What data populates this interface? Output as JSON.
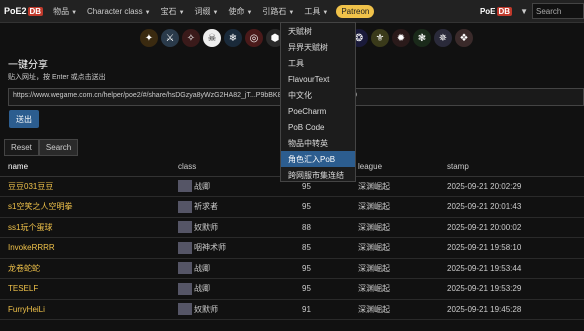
{
  "nav": {
    "logo": "PoE2",
    "logo_db": "DB",
    "items": [
      "物品",
      "Character class",
      "宝石",
      "词缀",
      "使命",
      "引路石",
      "工具"
    ],
    "patreon": "Patreon",
    "right_logo": "PoE",
    "right_logo_db": "DB",
    "search_placeholder": "Search",
    "lang": "▼"
  },
  "share": {
    "title": "一键分享",
    "desc": "贴入网址，按 Enter 或点击送出",
    "url": "https://www.wegame.com.cn/helper/poe2/#/share/hsDGzya8yWzG2HA82_jT...P9bBK8kKNyKcPSsOwjnKrli340",
    "send_label": "送出"
  },
  "tabs": [
    "Reset",
    "Search"
  ],
  "table": {
    "headers": [
      "name",
      "class",
      "level",
      "league",
      "stamp"
    ],
    "rows": [
      {
        "name": "豆豆031豆豆",
        "class": "战卿",
        "level": "95",
        "league": "深渊崛起",
        "stamp": "2025-09-21 20:02:29"
      },
      {
        "name": "s1空笑之人空明拳",
        "class": "祈求者",
        "level": "95",
        "league": "深渊崛起",
        "stamp": "2025-09-21 20:01:43"
      },
      {
        "name": "ss1玩个蛋球",
        "class": "奴默师",
        "level": "88",
        "league": "深渊崛起",
        "stamp": "2025-09-21 20:00:02"
      },
      {
        "name": "InvokeRRRR",
        "class": "咽神术师",
        "level": "85",
        "league": "深渊崛起",
        "stamp": "2025-09-21 19:58:10"
      },
      {
        "name": "龙卷蛇蛇",
        "class": "战卿",
        "level": "95",
        "league": "深渊崛起",
        "stamp": "2025-09-21 19:53:44"
      },
      {
        "name": "TESELF",
        "class": "战卿",
        "level": "95",
        "league": "深渊崛起",
        "stamp": "2025-09-21 19:53:29"
      },
      {
        "name": "FurryHeiLi",
        "class": "奴默师",
        "level": "91",
        "league": "深渊崛起",
        "stamp": "2025-09-21 19:45:28"
      }
    ]
  },
  "dropdown": {
    "items": [
      "天赋树",
      "异界天赋树",
      "工具",
      "FlavourText",
      "中文化",
      "PoeCharm",
      "PoB Code",
      "物品中转英",
      "角色汇入PoB",
      "跨网服市集连结"
    ],
    "highlighted_index": 8
  },
  "colors": {
    "accent": "#2c5d8f",
    "patreon": "#f0c24a",
    "name_color": "#f0c24a"
  }
}
